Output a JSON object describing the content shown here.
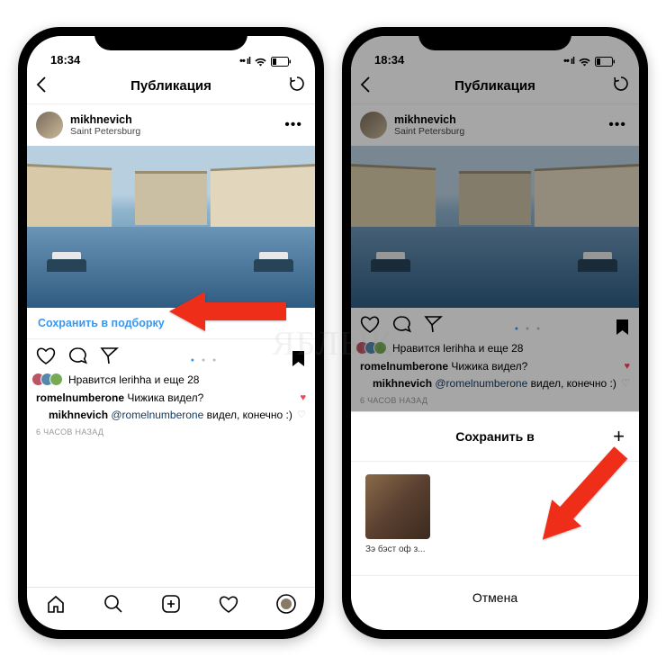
{
  "status": {
    "time": "18:34"
  },
  "appbar": {
    "title": "Публикация"
  },
  "post": {
    "username": "mikhnevich",
    "location": "Saint Petersburg",
    "save_to_collection": "Сохранить в подборку",
    "likes_text": "Нравится lerihha и еще 28",
    "comment1_user": "romelnumberone",
    "comment1_text": " Чижика видел?",
    "reply_user": "mikhnevich",
    "reply_mention": "@romelnumberone",
    "reply_text": " видел, конечно :)",
    "timestamp": "6 ЧАСОВ НАЗАД"
  },
  "sheet": {
    "title": "Сохранить в",
    "collection_label": "Зэ бэст оф з...",
    "cancel": "Отмена"
  },
  "watermark": "ЯБЛЫК"
}
